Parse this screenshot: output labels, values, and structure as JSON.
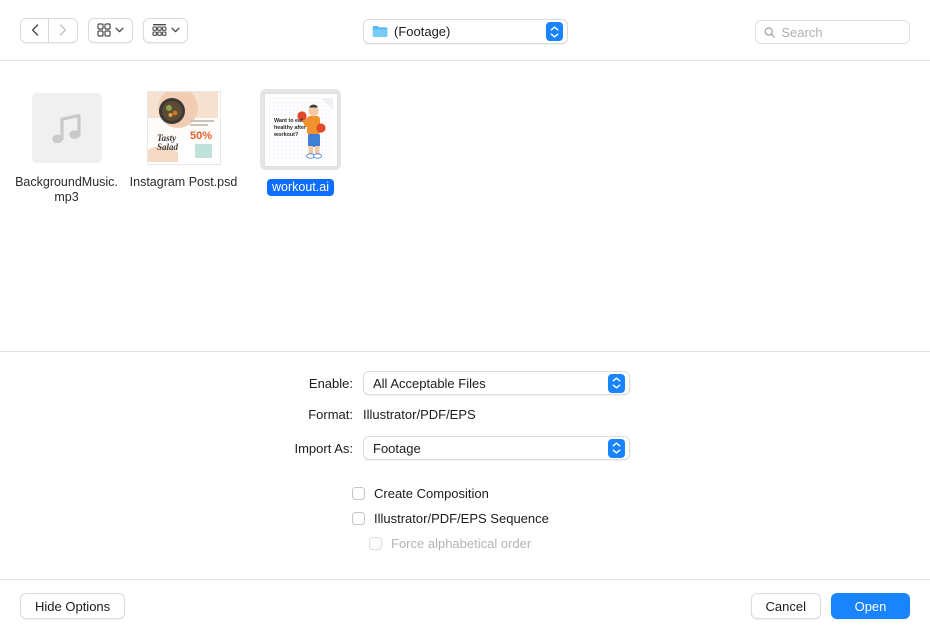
{
  "toolbar": {
    "back_icon": "chevron-left-icon",
    "forward_icon": "chevron-right-icon",
    "icon_view_label": "",
    "group_view_label": "",
    "path": {
      "label": "(Footage)",
      "folder_icon": "folder-icon"
    },
    "search": {
      "placeholder": "Search",
      "value": "",
      "icon": "search-icon"
    }
  },
  "browser": {
    "files": [
      {
        "name": "BackgroundMusic.mp3",
        "kind": "audio",
        "icon": "music-note-icon",
        "selected": false
      },
      {
        "name": "Instagram Post.psd",
        "kind": "image",
        "icon": "psd-thumbnail",
        "selected": false,
        "thumbnail_text": {
          "title_line1": "Tasty",
          "title_line2": "Salad",
          "promo": "50%"
        }
      },
      {
        "name": "workout.ai",
        "kind": "vector",
        "icon": "ai-thumbnail",
        "selected": true,
        "thumbnail_text": {
          "line1": "Want to eat",
          "line2": "healthy after",
          "line3": "workout?"
        }
      }
    ]
  },
  "options": {
    "enable": {
      "label": "Enable:",
      "value": "All Acceptable Files"
    },
    "format": {
      "label": "Format:",
      "value": "Illustrator/PDF/EPS"
    },
    "import_as": {
      "label": "Import As:",
      "value": "Footage"
    },
    "checkboxes": [
      {
        "label": "Create Composition",
        "checked": false,
        "disabled": false
      },
      {
        "label": "Illustrator/PDF/EPS Sequence",
        "checked": false,
        "disabled": false
      },
      {
        "label": "Force alphabetical order",
        "checked": false,
        "disabled": true
      }
    ]
  },
  "footer": {
    "hide_options_label": "Hide Options",
    "cancel_label": "Cancel",
    "open_label": "Open"
  },
  "colors": {
    "accent_blue": "#1a84ff",
    "selection_blue": "#0d6efd",
    "folder_blue": "#55b8f0"
  }
}
